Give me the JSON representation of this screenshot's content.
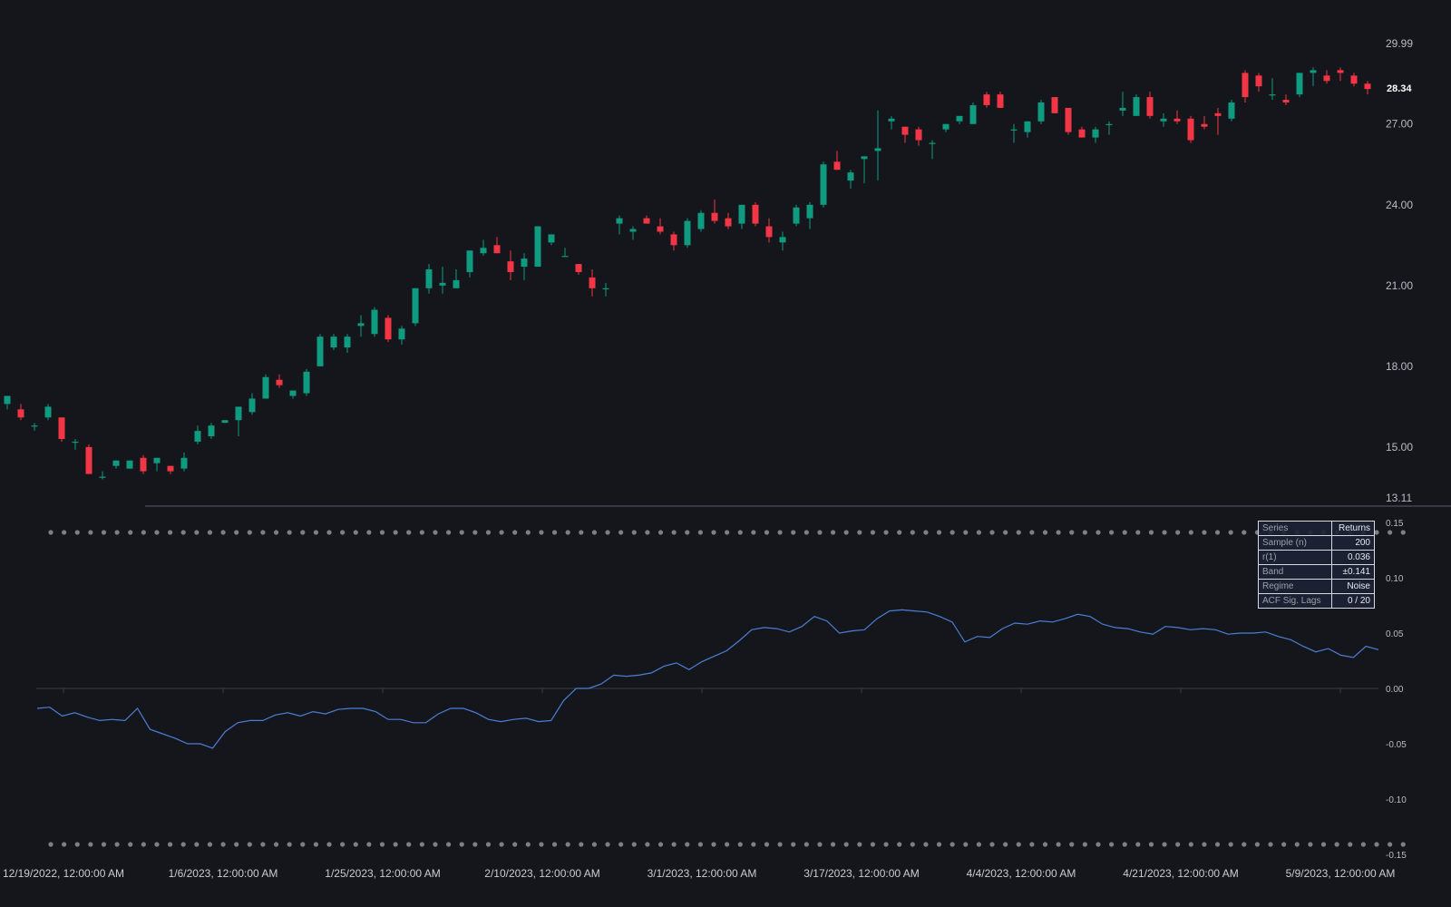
{
  "colors": {
    "background": "#14161b",
    "up": "#0f9b80",
    "down": "#f23645",
    "line": "#4a7fd4",
    "dots": "#7b7f87",
    "axis": "#3a3e46"
  },
  "price_axis": {
    "ticks": [
      "29.99",
      "27.00",
      "24.00",
      "21.00",
      "18.00",
      "15.00",
      "13.11"
    ],
    "last_price": "28.34"
  },
  "returns_axis": {
    "ticks": [
      "0.15",
      "0.10",
      "0.05",
      "0.00",
      "-0.05",
      "-0.10",
      "-0.15"
    ]
  },
  "date_axis": {
    "labels": [
      "12/19/2022, 12:00:00 AM",
      "1/6/2023, 12:00:00 AM",
      "1/25/2023, 12:00:00 AM",
      "2/10/2023, 12:00:00 AM",
      "3/1/2023, 12:00:00 AM",
      "3/17/2023, 12:00:00 AM",
      "4/4/2023, 12:00:00 AM",
      "4/21/2023, 12:00:00 AM",
      "5/9/2023, 12:00:00 AM"
    ]
  },
  "stats_table": {
    "rows": [
      {
        "key": "Series",
        "value": "Returns"
      },
      {
        "key": "Sample (n)",
        "value": "200"
      },
      {
        "key": "r(1)",
        "value": "0.036"
      },
      {
        "key": "Band",
        "value": "±0.141"
      },
      {
        "key": "Regime",
        "value": "Noise"
      },
      {
        "key": "ACF Sig. Lags",
        "value": "0 / 20"
      }
    ]
  },
  "chart_data": [
    {
      "type": "candlestick",
      "title": "",
      "ylim": [
        13.11,
        29.99
      ],
      "candles": [
        [
          16.6,
          16.9,
          16.4,
          16.9
        ],
        [
          16.4,
          16.6,
          16.0,
          16.1
        ],
        [
          15.8,
          15.9,
          15.6,
          15.8
        ],
        [
          16.1,
          16.6,
          16.0,
          16.5
        ],
        [
          16.1,
          16.1,
          15.2,
          15.3
        ],
        [
          15.2,
          15.3,
          14.9,
          15.2
        ],
        [
          15.0,
          15.1,
          14.0,
          14.0
        ],
        [
          13.9,
          14.1,
          13.8,
          13.9
        ],
        [
          14.3,
          14.5,
          14.2,
          14.5
        ],
        [
          14.2,
          14.5,
          14.2,
          14.5
        ],
        [
          14.6,
          14.7,
          14.0,
          14.1
        ],
        [
          14.4,
          14.6,
          14.1,
          14.6
        ],
        [
          14.3,
          14.3,
          14.0,
          14.1
        ],
        [
          14.2,
          14.8,
          14.1,
          14.6
        ],
        [
          15.2,
          15.8,
          15.1,
          15.6
        ],
        [
          15.4,
          15.9,
          15.3,
          15.8
        ],
        [
          15.9,
          16.0,
          15.9,
          16.0
        ],
        [
          16.0,
          16.3,
          15.4,
          16.5
        ],
        [
          16.3,
          17.0,
          16.2,
          16.8
        ],
        [
          16.8,
          17.7,
          16.8,
          17.6
        ],
        [
          17.5,
          17.7,
          17.2,
          17.3
        ],
        [
          16.9,
          17.1,
          16.8,
          17.1
        ],
        [
          17.0,
          17.9,
          16.9,
          17.8
        ],
        [
          18.0,
          19.2,
          18.0,
          19.1
        ],
        [
          18.7,
          19.2,
          18.6,
          19.1
        ],
        [
          18.7,
          19.2,
          18.5,
          19.1
        ],
        [
          19.5,
          19.9,
          19.1,
          19.6
        ],
        [
          19.2,
          20.2,
          19.1,
          20.1
        ],
        [
          19.8,
          19.9,
          18.9,
          19.0
        ],
        [
          19.0,
          19.5,
          18.8,
          19.4
        ],
        [
          19.6,
          20.9,
          19.5,
          20.9
        ],
        [
          20.9,
          21.8,
          20.7,
          21.6
        ],
        [
          21.0,
          21.7,
          20.7,
          21.1
        ],
        [
          20.9,
          21.6,
          20.9,
          21.2
        ],
        [
          21.5,
          22.3,
          21.3,
          22.3
        ],
        [
          22.2,
          22.7,
          22.1,
          22.4
        ],
        [
          22.5,
          22.8,
          22.2,
          22.2
        ],
        [
          21.9,
          22.3,
          21.2,
          21.5
        ],
        [
          21.7,
          22.2,
          21.2,
          22.0
        ],
        [
          21.7,
          23.2,
          21.7,
          23.2
        ],
        [
          22.6,
          22.9,
          22.5,
          22.9
        ],
        [
          22.1,
          22.4,
          22.1,
          22.1
        ],
        [
          21.8,
          21.8,
          21.4,
          21.5
        ],
        [
          21.3,
          21.6,
          20.6,
          20.9
        ],
        [
          20.9,
          21.1,
          20.6,
          20.9
        ],
        [
          23.3,
          23.6,
          22.9,
          23.5
        ],
        [
          23.0,
          23.2,
          22.7,
          23.1
        ],
        [
          23.5,
          23.6,
          23.3,
          23.3
        ],
        [
          23.2,
          23.5,
          22.9,
          23.0
        ],
        [
          22.9,
          23.0,
          22.3,
          22.5
        ],
        [
          22.5,
          23.5,
          22.4,
          23.4
        ],
        [
          23.1,
          23.8,
          23.0,
          23.7
        ],
        [
          23.7,
          24.2,
          23.3,
          23.4
        ],
        [
          23.5,
          23.7,
          23.1,
          23.2
        ],
        [
          23.3,
          24.0,
          23.1,
          24.0
        ],
        [
          24.0,
          24.1,
          23.2,
          23.3
        ],
        [
          23.2,
          23.5,
          22.6,
          22.8
        ],
        [
          22.6,
          23.0,
          22.3,
          22.8
        ],
        [
          23.3,
          24.0,
          23.2,
          23.9
        ],
        [
          23.5,
          24.1,
          23.1,
          24.0
        ],
        [
          24.0,
          25.6,
          23.9,
          25.5
        ],
        [
          25.6,
          26.0,
          25.3,
          25.3
        ],
        [
          24.9,
          25.3,
          24.6,
          25.2
        ],
        [
          25.7,
          25.8,
          24.8,
          25.8
        ],
        [
          26.0,
          27.5,
          24.9,
          26.1
        ],
        [
          27.1,
          27.3,
          26.8,
          27.2
        ],
        [
          26.9,
          26.9,
          26.3,
          26.6
        ],
        [
          26.8,
          26.9,
          26.2,
          26.4
        ],
        [
          26.3,
          26.4,
          25.7,
          26.3
        ],
        [
          26.8,
          27.0,
          26.7,
          27.0
        ],
        [
          27.1,
          27.3,
          27.0,
          27.3
        ],
        [
          27.0,
          27.8,
          27.0,
          27.7
        ],
        [
          28.1,
          28.2,
          27.6,
          27.7
        ],
        [
          28.1,
          28.2,
          27.6,
          27.6
        ],
        [
          26.8,
          27.0,
          26.3,
          26.8
        ],
        [
          26.7,
          27.1,
          26.5,
          27.1
        ],
        [
          27.1,
          27.9,
          27.0,
          27.8
        ],
        [
          28.0,
          28.0,
          27.4,
          27.4
        ],
        [
          27.6,
          27.6,
          26.6,
          26.7
        ],
        [
          26.8,
          26.9,
          26.5,
          26.5
        ],
        [
          26.5,
          26.9,
          26.3,
          26.8
        ],
        [
          27.0,
          27.1,
          26.6,
          27.0
        ],
        [
          27.5,
          28.2,
          27.3,
          27.6
        ],
        [
          27.3,
          28.1,
          27.3,
          28.0
        ],
        [
          28.0,
          28.2,
          27.2,
          27.3
        ],
        [
          27.1,
          27.4,
          26.9,
          27.2
        ],
        [
          27.2,
          27.5,
          27.0,
          27.1
        ],
        [
          27.2,
          27.3,
          26.3,
          26.4
        ],
        [
          27.0,
          27.3,
          26.8,
          26.9
        ],
        [
          27.4,
          27.6,
          26.6,
          27.3
        ],
        [
          27.2,
          27.9,
          27.1,
          27.8
        ],
        [
          28.9,
          29.0,
          27.8,
          28.0
        ],
        [
          28.8,
          28.9,
          28.2,
          28.4
        ],
        [
          28.1,
          28.7,
          27.9,
          28.1
        ],
        [
          27.9,
          28.1,
          27.7,
          27.8
        ],
        [
          28.1,
          28.9,
          28.0,
          28.9
        ],
        [
          28.9,
          29.1,
          28.4,
          29.0
        ],
        [
          28.8,
          29.0,
          28.5,
          28.6
        ],
        [
          29.0,
          29.1,
          28.6,
          28.9
        ],
        [
          28.8,
          28.9,
          28.4,
          28.5
        ],
        [
          28.5,
          28.6,
          28.1,
          28.3
        ]
      ]
    },
    {
      "type": "line",
      "title": "",
      "ylim": [
        -0.15,
        0.15
      ],
      "y": [
        -0.018,
        -0.017,
        -0.025,
        -0.022,
        -0.026,
        -0.029,
        -0.028,
        -0.029,
        -0.018,
        -0.037,
        -0.041,
        -0.045,
        -0.05,
        -0.05,
        -0.054,
        -0.039,
        -0.031,
        -0.029,
        -0.029,
        -0.024,
        -0.022,
        -0.025,
        -0.021,
        -0.023,
        -0.019,
        -0.018,
        -0.018,
        -0.021,
        -0.028,
        -0.028,
        -0.031,
        -0.031,
        -0.023,
        -0.018,
        -0.018,
        -0.022,
        -0.028,
        -0.03,
        -0.028,
        -0.027,
        -0.03,
        -0.029,
        -0.011,
        0.0,
        0.0,
        0.004,
        0.012,
        0.011,
        0.012,
        0.014,
        0.02,
        0.023,
        0.017,
        0.024,
        0.029,
        0.034,
        0.043,
        0.053,
        0.055,
        0.054,
        0.051,
        0.056,
        0.065,
        0.061,
        0.05,
        0.052,
        0.053,
        0.063,
        0.07,
        0.071,
        0.07,
        0.069,
        0.065,
        0.06,
        0.042,
        0.047,
        0.046,
        0.054,
        0.059,
        0.058,
        0.061,
        0.06,
        0.063,
        0.067,
        0.065,
        0.058,
        0.055,
        0.054,
        0.051,
        0.049,
        0.056,
        0.055,
        0.053,
        0.054,
        0.053,
        0.049,
        0.05,
        0.05,
        0.051,
        0.047,
        0.044,
        0.038,
        0.033,
        0.036,
        0.03,
        0.028,
        0.038,
        0.035
      ]
    }
  ]
}
